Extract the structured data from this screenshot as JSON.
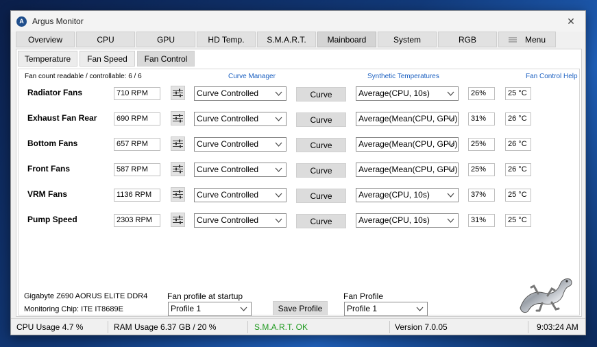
{
  "window": {
    "title": "Argus Monitor",
    "icon_letter": "A",
    "close_glyph": "✕"
  },
  "main_tabs": [
    {
      "label": "Overview"
    },
    {
      "label": "CPU"
    },
    {
      "label": "GPU"
    },
    {
      "label": "HD Temp."
    },
    {
      "label": "S.M.A.R.T."
    },
    {
      "label": "Mainboard",
      "active": true
    },
    {
      "label": "System"
    },
    {
      "label": "RGB"
    },
    {
      "label": "Menu",
      "icon": "hamburger-menu-icon"
    }
  ],
  "sub_tabs": [
    {
      "label": "Temperature"
    },
    {
      "label": "Fan Speed"
    },
    {
      "label": "Fan Control",
      "active": true
    }
  ],
  "header": {
    "fan_count": "Fan count readable / controllable: 6 / 6",
    "curve_manager": "Curve Manager",
    "synthetic_temps": "Synthetic Temperatures",
    "help": "Fan Control Help"
  },
  "fans": [
    {
      "name": "Radiator Fans",
      "rpm": "710 RPM",
      "mode": "Curve Controlled",
      "curve": "Curve",
      "source": "Average(CPU, 10s)",
      "percent": "26%",
      "temp": "25 °C"
    },
    {
      "name": "Exhaust Fan Rear",
      "rpm": "690 RPM",
      "mode": "Curve Controlled",
      "curve": "Curve",
      "source": "Average(Mean(CPU, GPU)",
      "percent": "31%",
      "temp": "26 °C"
    },
    {
      "name": "Bottom Fans",
      "rpm": "657 RPM",
      "mode": "Curve Controlled",
      "curve": "Curve",
      "source": "Average(Mean(CPU, GPU)",
      "percent": "25%",
      "temp": "26 °C"
    },
    {
      "name": "Front Fans",
      "rpm": "587 RPM",
      "mode": "Curve Controlled",
      "curve": "Curve",
      "source": "Average(Mean(CPU, GPU)",
      "percent": "25%",
      "temp": "26 °C"
    },
    {
      "name": "VRM Fans",
      "rpm": "1136 RPM",
      "mode": "Curve Controlled",
      "curve": "Curve",
      "source": "Average(CPU, 10s)",
      "percent": "37%",
      "temp": "25 °C"
    },
    {
      "name": "Pump Speed",
      "rpm": "2303 RPM",
      "mode": "Curve Controlled",
      "curve": "Curve",
      "source": "Average(CPU, 10s)",
      "percent": "31%",
      "temp": "25 °C"
    }
  ],
  "footer": {
    "board": "Gigabyte Z690 AORUS ELITE DDR4",
    "chip": "Monitoring Chip: ITE IT8689E",
    "startup_label": "Fan profile at startup",
    "startup_value": "Profile 1",
    "save_label": "Save Profile",
    "profile_label": "Fan Profile",
    "profile_value": "Profile 1"
  },
  "status": {
    "cpu": "CPU Usage 4.7 %",
    "ram": "RAM Usage 6.37 GB / 20 %",
    "smart": "S.M.A.R.T. OK",
    "version": "Version 7.0.05",
    "time": "9:03:24 AM"
  },
  "colors": {
    "link": "#1a5fc0",
    "ok": "#1f9a1f",
    "icon_blue": "#1f4e8c"
  }
}
